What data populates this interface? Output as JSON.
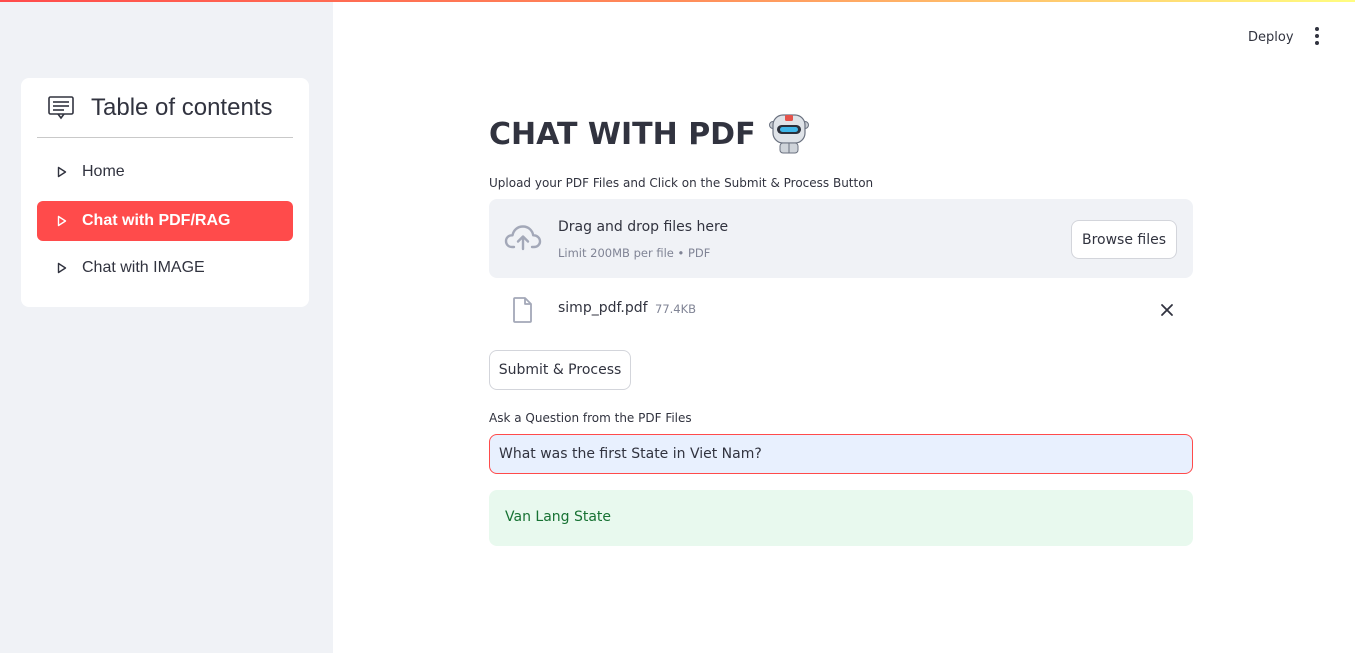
{
  "sidebar": {
    "toc_title": "Table of contents",
    "items": [
      {
        "label": "Home",
        "active": false
      },
      {
        "label": "Chat with PDF/RAG",
        "active": true
      },
      {
        "label": "Chat with IMAGE",
        "active": false
      }
    ],
    "accent": "#ff4b4b",
    "background": "#f0f2f6"
  },
  "header": {
    "deploy_label": "Deploy",
    "menu_icon": "more-vertical-icon"
  },
  "main": {
    "title": "CHAT WITH PDF",
    "title_icon": "robot-icon",
    "upload_label": "Upload your PDF Files and Click on the Submit & Process Button",
    "dropzone": {
      "icon": "cloud-upload-icon",
      "main_text": "Drag and drop files here",
      "sub_text": "Limit 200MB per file • PDF",
      "browse_label": "Browse files"
    },
    "uploaded_file": {
      "icon": "file-icon",
      "name": "simp_pdf.pdf",
      "size": "77.4KB",
      "remove_icon": "close-icon"
    },
    "submit_label": "Submit & Process",
    "question_label": "Ask a Question from the PDF Files",
    "question_value": "What was the first State in Viet Nam?",
    "answer": "Van Lang State",
    "answer_color": "#177233"
  }
}
